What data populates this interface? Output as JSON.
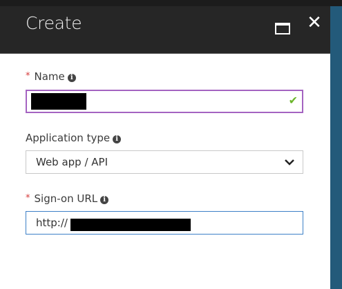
{
  "header": {
    "title": "Create",
    "maximize_icon": "maximize-icon",
    "close_icon": "close-icon",
    "close_glyph": "✕"
  },
  "form": {
    "name": {
      "label": "Name",
      "required": true,
      "required_mark": "*",
      "value": "",
      "valid_icon": "checkmark-icon",
      "valid_glyph": "✔",
      "border_color": "#a463c1"
    },
    "application_type": {
      "label": "Application type",
      "selected": "Web app / API",
      "chevron_glyph": "⌄"
    },
    "sign_on_url": {
      "label": "Sign-on URL",
      "required": true,
      "required_mark": "*",
      "value": "http://",
      "border_color": "#3c7fc7"
    }
  },
  "info_glyph": "i",
  "colors": {
    "header_bg": "#262626",
    "accent_strip": "#235a7a",
    "required": "#d53a3a",
    "valid": "#6bb52a"
  }
}
